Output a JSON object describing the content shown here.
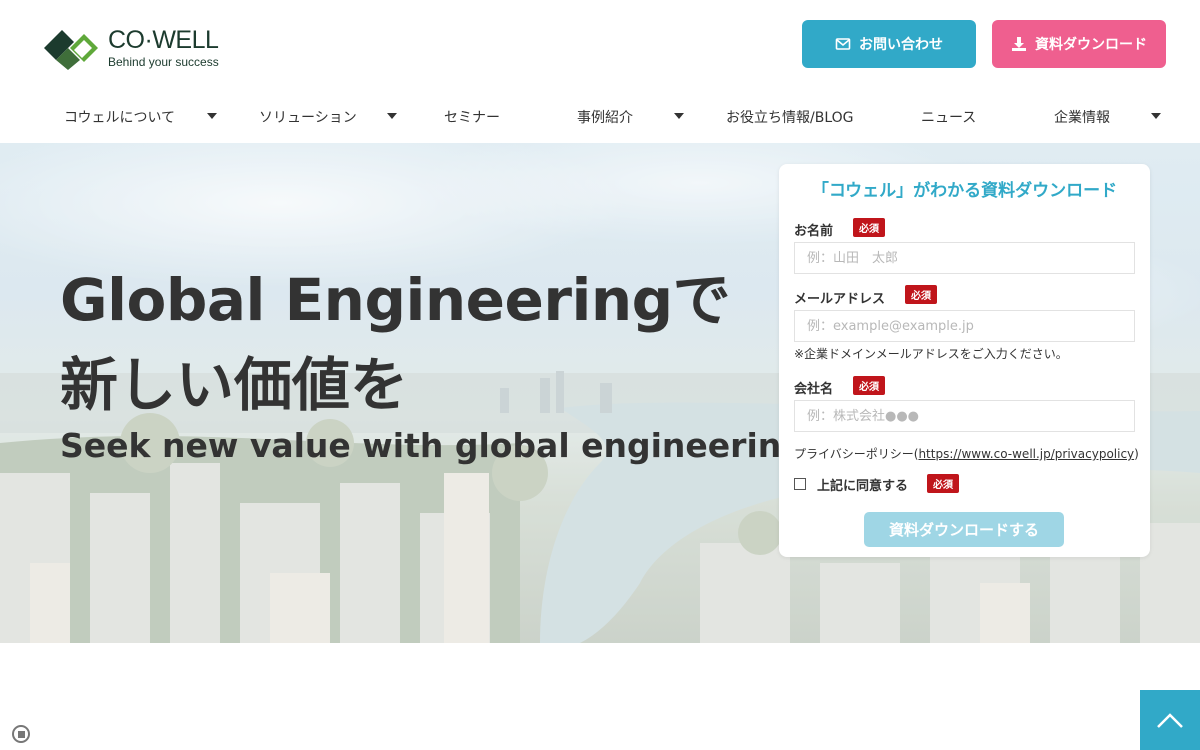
{
  "brand": {
    "name": "CO·WELL",
    "tagline": "Behind your success",
    "colors": {
      "accent": "#31a9c8",
      "pink": "#ef5f8f",
      "required": "#c0151b",
      "logo_dark": "#1c3b2e",
      "logo_green": "#5fa83a"
    }
  },
  "header_buttons": {
    "contact": {
      "label": "お問い合わせ",
      "icon": "mail-icon"
    },
    "download": {
      "label": "資料ダウンロード",
      "icon": "download-icon"
    }
  },
  "nav": {
    "items": [
      {
        "label": "コウェルについて",
        "has_dropdown": true
      },
      {
        "label": "ソリューション",
        "has_dropdown": true
      },
      {
        "label": "セミナー",
        "has_dropdown": false
      },
      {
        "label": "事例紹介",
        "has_dropdown": true
      },
      {
        "label": "お役立ち情報/BLOG",
        "has_dropdown": false
      },
      {
        "label": "ニュース",
        "has_dropdown": false
      },
      {
        "label": "企業情報",
        "has_dropdown": true
      }
    ]
  },
  "hero": {
    "title_line1": "Global Engineeringで",
    "title_line2": "新しい価値を",
    "subtitle": "Seek new value with global engineering"
  },
  "form": {
    "title": "「コウェル」がわかる資料ダウンロード",
    "required_badge": "必須",
    "name": {
      "label": "お名前",
      "placeholder": "例：山田　太郎",
      "value": ""
    },
    "email": {
      "label": "メールアドレス",
      "placeholder": "例：example@example.jp",
      "value": "",
      "note": "※企業ドメインメールアドレスをご入力ください。"
    },
    "company": {
      "label": "会社名",
      "placeholder": "例：株式会社●●●",
      "value": ""
    },
    "privacy": {
      "prefix": "プライバシーポリシー(",
      "link": "https://www.co-well.jp/privacypolicy",
      "suffix": ")"
    },
    "agree": {
      "label": "上記に同意する",
      "checked": false
    },
    "submit_label": "資料ダウンロードする"
  }
}
